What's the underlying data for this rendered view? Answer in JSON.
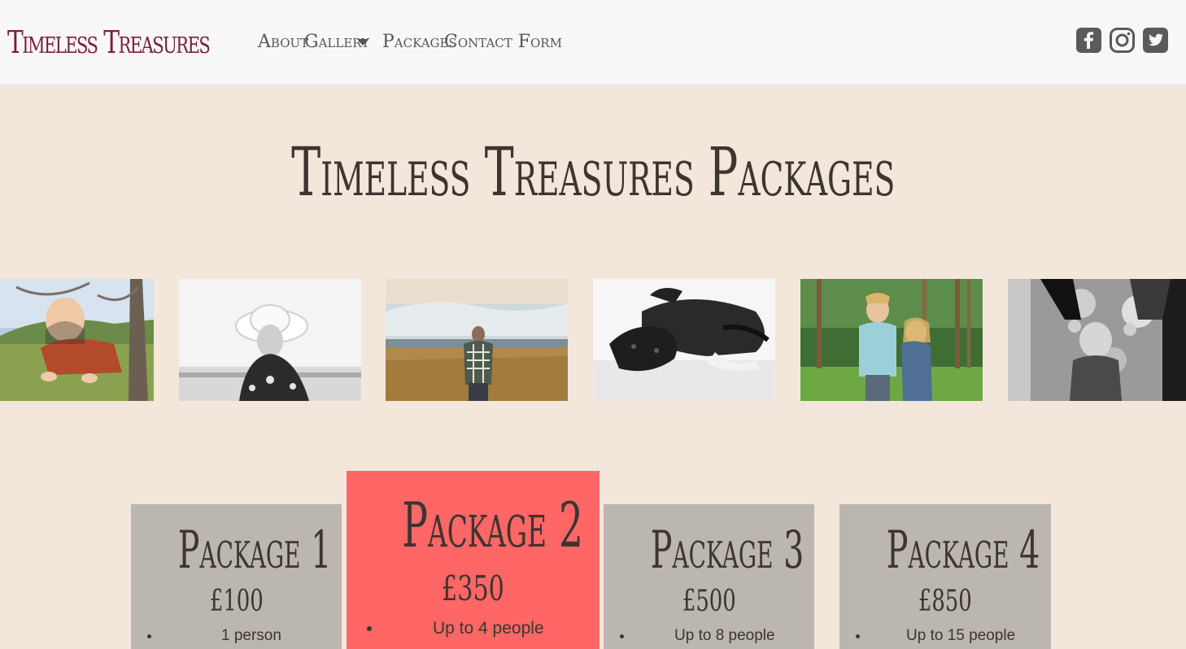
{
  "nav": {
    "brand": "Timeless Treasures",
    "links": [
      "About",
      "Gallery",
      "Packages",
      "Contact Form"
    ],
    "social": [
      "facebook-icon",
      "instagram-icon",
      "twitter-icon"
    ]
  },
  "hero": {
    "title": "Timeless Treasures Packages"
  },
  "gallery": {
    "photos": [
      {
        "subject": "baby crawling in grass"
      },
      {
        "subject": "woman in white sun hat"
      },
      {
        "subject": "man in plaid shirt by lake"
      },
      {
        "subject": "black dog lying down"
      },
      {
        "subject": "two children hugging in park"
      },
      {
        "subject": "baby held by parents"
      }
    ]
  },
  "packages": [
    {
      "title": "Package 1",
      "price": "£100",
      "feature": "1 person"
    },
    {
      "title": "Package 2",
      "price": "£350",
      "feature": "Up to 4 people"
    },
    {
      "title": "Package 3",
      "price": "£500",
      "feature": "Up to 8 people"
    },
    {
      "title": "Package 4",
      "price": "£850",
      "feature": "Up to 15 people"
    }
  ],
  "colors": {
    "brand": "#7a1f33",
    "background": "#f3e7dc",
    "card": "#bcb6b0",
    "featured_card": "#ff6666"
  }
}
